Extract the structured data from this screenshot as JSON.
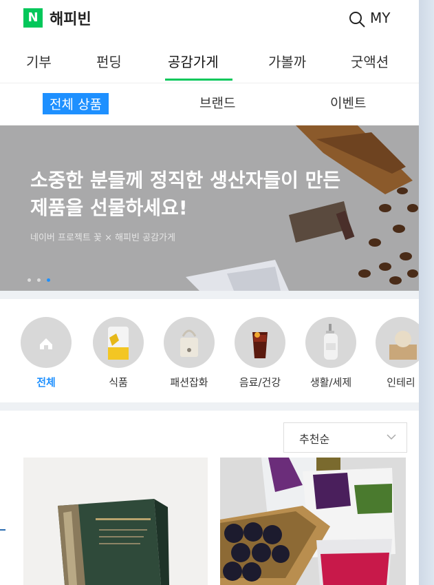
{
  "header": {
    "logo_letter": "N",
    "title": "해피빈",
    "my_label": "MY"
  },
  "tabs": [
    "기부",
    "펀딩",
    "공감가게",
    "가볼까",
    "굿액션"
  ],
  "subtabs": [
    "전체 상품",
    "브랜드",
    "이벤트"
  ],
  "banner": {
    "headline": "소중한 분들께 정직한 생산자들이 만든 제품을 선물하세요!",
    "subtext": "네이버 프로젝트 꽃 × 해피빈 공감가게"
  },
  "categories": [
    "전체",
    "식품",
    "패션잡화",
    "음료/건강",
    "생활/세제",
    "인테리"
  ],
  "sort": {
    "selected": "추천순"
  },
  "colors": {
    "brand_green": "#03c75a",
    "accent_blue": "#1e90ff"
  }
}
